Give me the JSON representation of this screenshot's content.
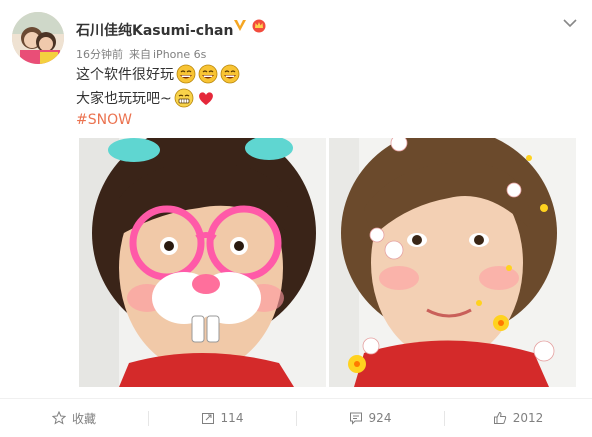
{
  "post": {
    "author": "石川佳纯Kasumi-chan",
    "time": "16分钟前",
    "source_prefix": "来自",
    "source": "iPhone 6s",
    "line1": "这个软件很好玩",
    "line2": "大家也玩玩吧~",
    "hashtag": "#SNOW",
    "emoji_line1": [
      "laugh-emoji",
      "laugh-emoji",
      "laugh-emoji"
    ],
    "emoji_line2": [
      "grin-emoji",
      "heart-emoji"
    ]
  },
  "actions": {
    "favorite": "收藏",
    "repost_count": "114",
    "comment_count": "924",
    "like_count": "2012"
  },
  "colors": {
    "accent": "#eb7350",
    "verified": "#f5a623",
    "text": "#333333",
    "meta": "#808080"
  }
}
